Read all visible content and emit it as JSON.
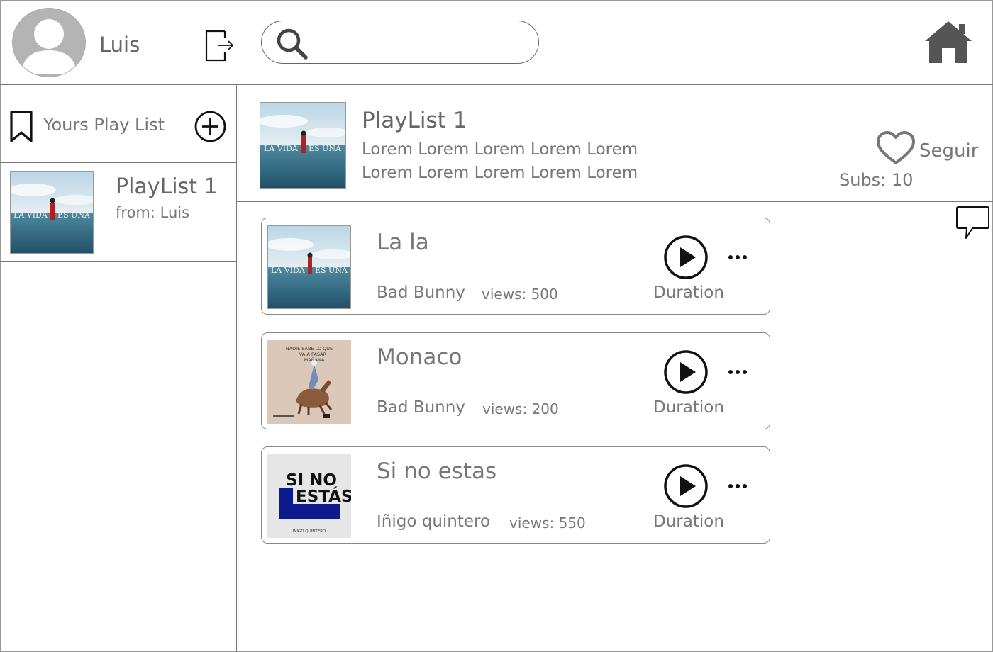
{
  "user": {
    "name": "Luis"
  },
  "search": {
    "placeholder": "",
    "value": ""
  },
  "sidebar": {
    "title": "Yours Play List",
    "playlists": [
      {
        "title": "PlayList 1",
        "owner": "from: Luis",
        "cover": "la-vida-es-una"
      }
    ]
  },
  "playlist": {
    "title": "PlayList 1",
    "description": [
      "Lorem Lorem Lorem Lorem Lorem",
      "Lorem Lorem Lorem Lorem Lorem"
    ],
    "follow_label": "Seguir",
    "subs": "Subs: 10",
    "cover": "la-vida-es-una"
  },
  "songs": [
    {
      "title": "La la",
      "artist": "Bad Bunny",
      "views": "views: 500",
      "duration": "Duration",
      "cover": "la-vida-es-una"
    },
    {
      "title": "Monaco",
      "artist": "Bad Bunny",
      "views": "views: 200",
      "duration": "Duration",
      "cover": "nadie-sabe"
    },
    {
      "title": "Si no estas",
      "artist": "Iñigo quintero",
      "views": "views: 550",
      "duration": "Duration",
      "cover": "si-no-estas"
    }
  ],
  "covers": {
    "la_vida_text": [
      "LA VIDA",
      "ES UNA"
    ],
    "nadie_sabe_text": [
      "NADIE SABE LO QUE",
      "VA A PASAR",
      "MAÑANA"
    ],
    "si_no_estas_text": [
      "SI NO",
      "ESTÁS",
      "IÑIGO QUINTERO"
    ]
  },
  "icons": {
    "logout": "logout-icon",
    "search": "search-icon",
    "home": "home-icon",
    "bookmark": "bookmark-icon",
    "add": "add-circle-icon",
    "heart": "heart-icon",
    "comment": "comment-icon",
    "play": "play-circle-icon",
    "more": "more-dots-icon"
  },
  "colors": {
    "icon_dark": "#111111",
    "icon_gray": "#555555",
    "text": "#666666",
    "border": "#777777"
  }
}
